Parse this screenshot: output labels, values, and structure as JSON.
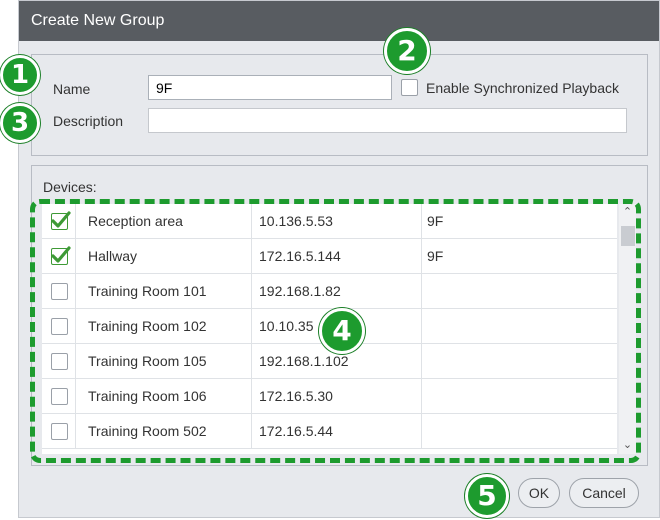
{
  "dialog": {
    "title": "Create New Group"
  },
  "form": {
    "name_label": "Name",
    "name_value": "9F",
    "description_label": "Description",
    "description_value": "",
    "sync_label": "Enable Synchronized Playback"
  },
  "devices": {
    "label": "Devices:",
    "rows": [
      {
        "checked": true,
        "name": "Reception area",
        "ip": "10.136.5.53",
        "group": "9F"
      },
      {
        "checked": true,
        "name": "Hallway",
        "ip": "172.16.5.144",
        "group": "9F"
      },
      {
        "checked": false,
        "name": "Training Room 101",
        "ip": "192.168.1.82",
        "group": ""
      },
      {
        "checked": false,
        "name": "Training Room 102",
        "ip": "10.10.35",
        "group": ""
      },
      {
        "checked": false,
        "name": "Training Room 105",
        "ip": "192.168.1.102",
        "group": ""
      },
      {
        "checked": false,
        "name": "Training Room 106",
        "ip": "172.16.5.30",
        "group": ""
      },
      {
        "checked": false,
        "name": "Training Room 502",
        "ip": "172.16.5.44",
        "group": ""
      }
    ]
  },
  "buttons": {
    "ok": "OK",
    "cancel": "Cancel"
  },
  "callouts": [
    "1",
    "2",
    "3",
    "4",
    "5"
  ],
  "colors": {
    "callout": "#1d9b2e",
    "titlebar": "#585c61",
    "check": "#3e9a36"
  }
}
